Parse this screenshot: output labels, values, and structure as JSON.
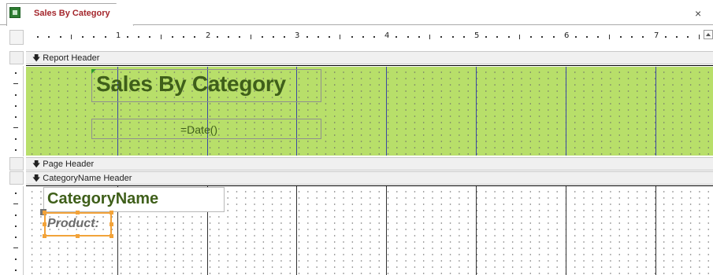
{
  "tab": {
    "title": "Sales By Category",
    "icon": "report-icon"
  },
  "window": {
    "close_label": "×"
  },
  "ruler": {
    "numbers": [
      "1",
      "2",
      "3",
      "4",
      "5",
      "6",
      "7"
    ]
  },
  "sections": {
    "report_header": "Report Header",
    "page_header": "Page Header",
    "category_header": "CategoryName Header"
  },
  "controls": {
    "title": "Sales By Category",
    "date": "=Date()",
    "category_name": "CategoryName",
    "product_label": "Product:"
  },
  "colors": {
    "band_fill": "#b8df6a",
    "title_text": "#3f5f1a",
    "selection": "#f2a33a",
    "tab_title": "#a4262c"
  }
}
